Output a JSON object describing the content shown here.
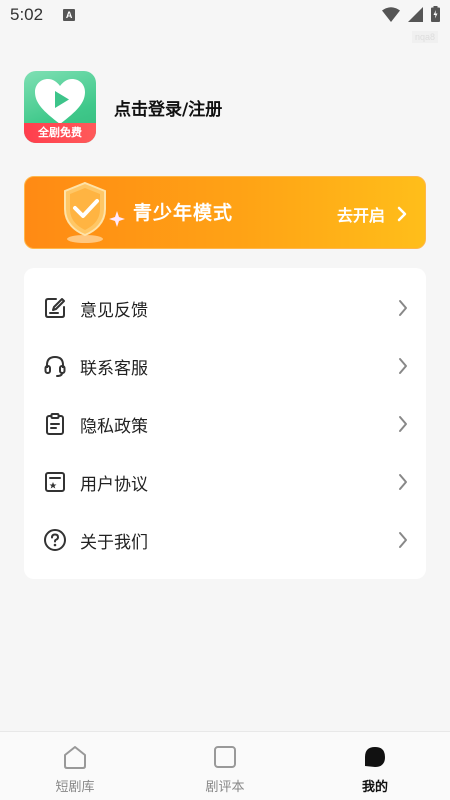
{
  "status_bar": {
    "time": "5:02",
    "notification_glyph": "A",
    "tag": "nqa8"
  },
  "header": {
    "logo_badge": "全剧免费",
    "login_text": "点击登录/注册"
  },
  "youth_mode": {
    "title": "青少年模式",
    "action": "去开启",
    "gradient_start": "#ff8a14",
    "gradient_end": "#ffbe1a"
  },
  "menu": {
    "items": [
      {
        "label": "意见反馈",
        "icon": "feedback-edit-icon"
      },
      {
        "label": "联系客服",
        "icon": "headset-icon"
      },
      {
        "label": "隐私政策",
        "icon": "clipboard-icon"
      },
      {
        "label": "用户协议",
        "icon": "agreement-icon"
      },
      {
        "label": "关于我们",
        "icon": "question-circle-icon"
      }
    ]
  },
  "bottom_nav": {
    "items": [
      {
        "label": "短剧库",
        "icon": "home-icon",
        "active": false
      },
      {
        "label": "剧评本",
        "icon": "square-icon",
        "active": false
      },
      {
        "label": "我的",
        "icon": "profile-blob-icon",
        "active": true
      }
    ]
  },
  "colors": {
    "background": "#f6f6f6",
    "card": "#ffffff",
    "text_primary": "#222222",
    "nav_inactive": "#888888",
    "logo_green": "#3fc88a",
    "logo_red": "#ff3e4d"
  }
}
